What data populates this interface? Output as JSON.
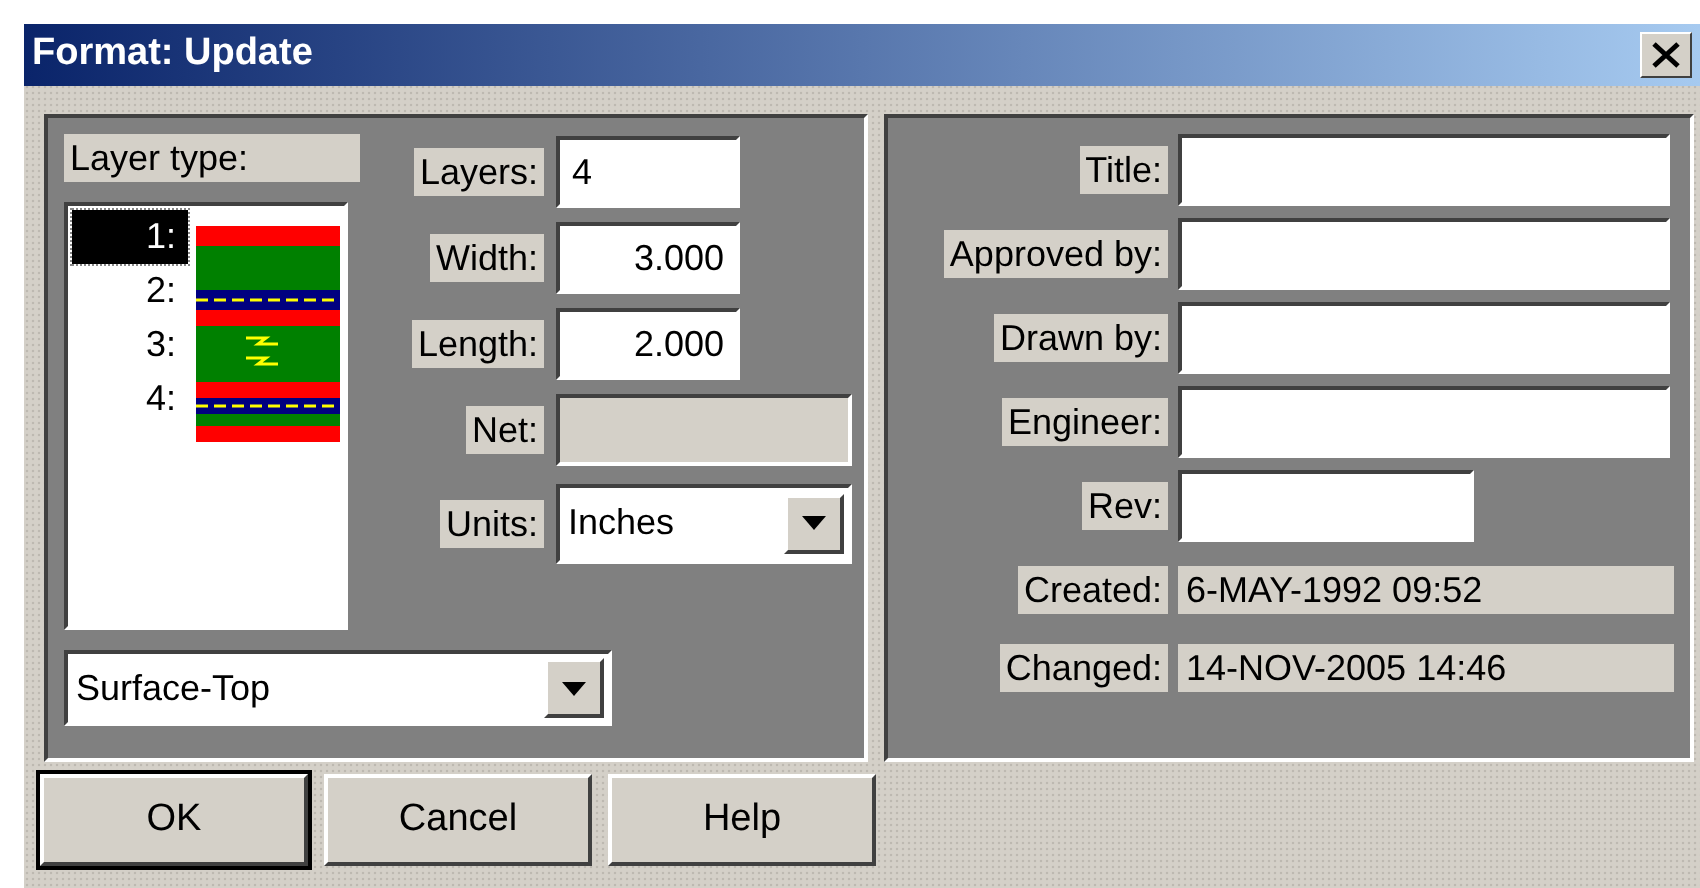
{
  "window": {
    "title": "Format: Update"
  },
  "left_panel": {
    "layer_type_label": "Layer type:",
    "layers": [
      {
        "label": "1:",
        "selected": true
      },
      {
        "label": "2:",
        "selected": false
      },
      {
        "label": "3:",
        "selected": false
      },
      {
        "label": "4:",
        "selected": false
      }
    ],
    "fields": [
      {
        "kind": "text",
        "label": "Layers:",
        "value": "4",
        "numeric": false
      },
      {
        "kind": "text",
        "label": "Width:",
        "value": "3.000",
        "numeric": true
      },
      {
        "kind": "text",
        "label": "Length:",
        "value": "2.000",
        "numeric": true
      },
      {
        "kind": "readonly",
        "label": "Net:"
      },
      {
        "kind": "select",
        "label": "Units:",
        "value": "Inches"
      }
    ],
    "layer_type_select": {
      "value": "Surface-Top"
    }
  },
  "right_panel": {
    "fields": [
      {
        "kind": "text",
        "label": "Title:"
      },
      {
        "kind": "text",
        "label": "Approved by:"
      },
      {
        "kind": "text",
        "label": "Drawn by:"
      },
      {
        "kind": "text",
        "label": "Engineer:"
      },
      {
        "kind": "short",
        "label": "Rev:"
      },
      {
        "kind": "info",
        "label": "Created:",
        "value": "6-MAY-1992 09:52"
      },
      {
        "kind": "info",
        "label": "Changed:",
        "value": "14-NOV-2005 14:46"
      }
    ]
  },
  "buttons": [
    {
      "label": "OK",
      "default": true
    },
    {
      "label": "Cancel",
      "default": false
    },
    {
      "label": "Help",
      "default": false
    }
  ]
}
